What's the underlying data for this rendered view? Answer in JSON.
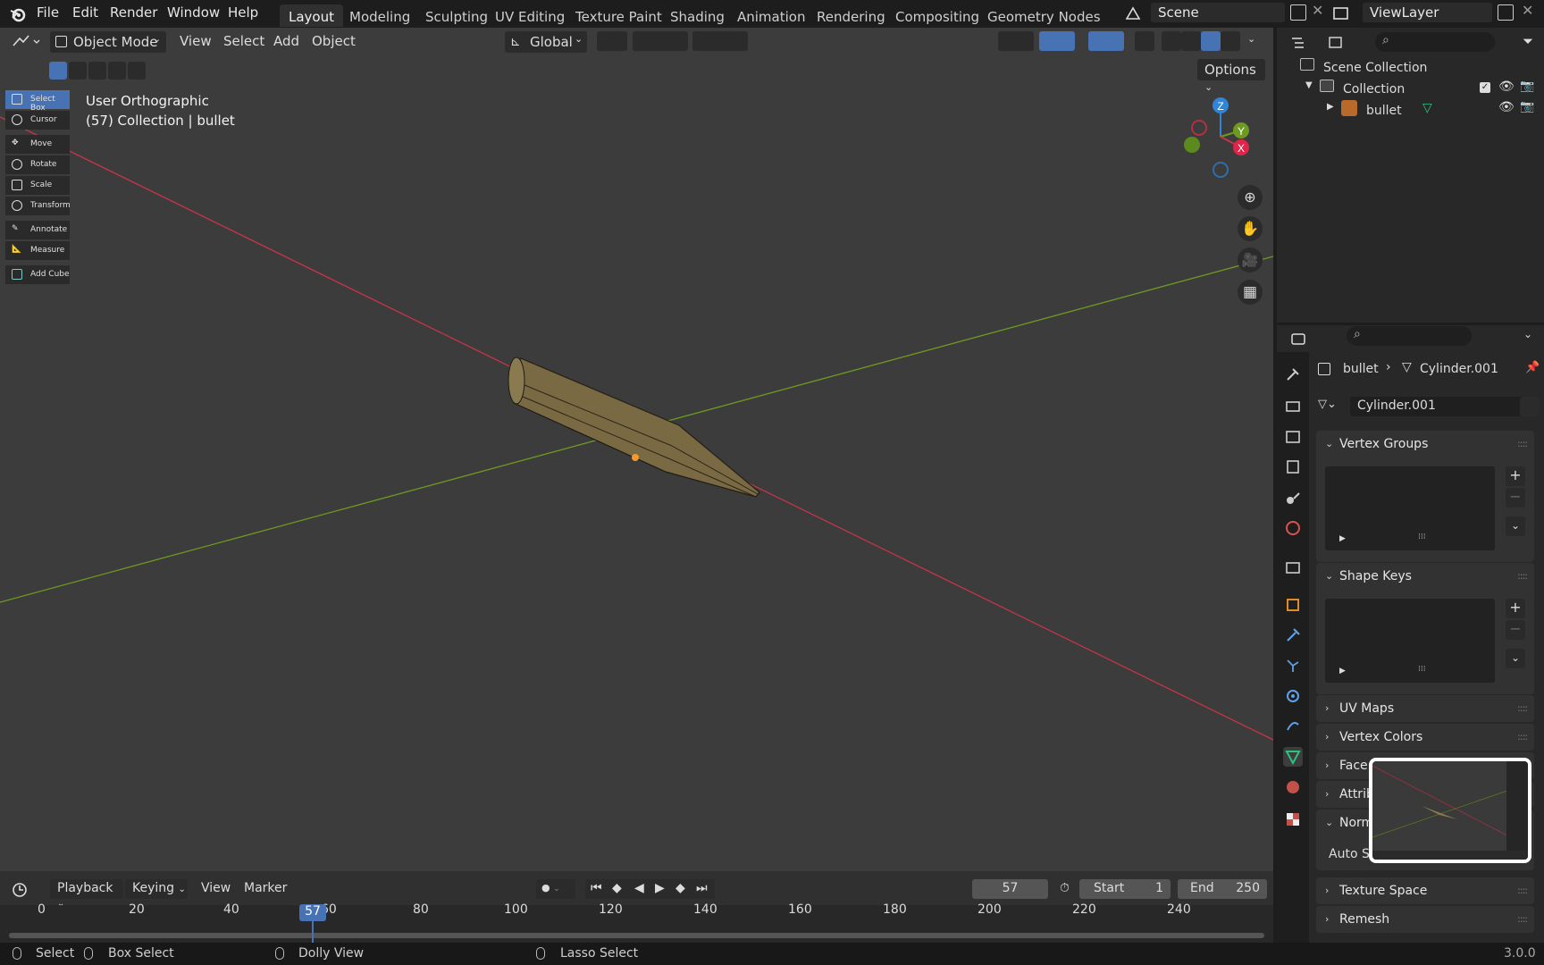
{
  "menubar": {
    "items": [
      "File",
      "Edit",
      "Render",
      "Window",
      "Help"
    ],
    "workspaces": [
      "Layout",
      "Modeling",
      "Sculpting",
      "UV Editing",
      "Texture Paint",
      "Shading",
      "Animation",
      "Rendering",
      "Compositing",
      "Geometry Nodes"
    ],
    "active_workspace": "Layout",
    "scene": "Scene",
    "view_layer": "ViewLayer"
  },
  "viewport_header": {
    "mode": "Object Mode",
    "menus": [
      "View",
      "Select",
      "Add",
      "Object"
    ],
    "orientation": "Global",
    "options": "Options"
  },
  "viewport": {
    "view_name": "User Orthographic",
    "info": "(57) Collection | bullet",
    "gizmo": {
      "x": "X",
      "y": "Y",
      "z": "Z"
    }
  },
  "toolbar": {
    "tools": [
      "Select Box",
      "Cursor",
      "Move",
      "Rotate",
      "Scale",
      "Transform",
      "Annotate",
      "Measure",
      "Add Cube"
    ],
    "active": "Select Box"
  },
  "outliner": {
    "root": "Scene Collection",
    "collection": "Collection",
    "object": "bullet"
  },
  "properties": {
    "breadcrumb_object": "bullet",
    "breadcrumb_data": "Cylinder.001",
    "mesh_name": "Cylinder.001",
    "panels": [
      "Vertex Groups",
      "Shape Keys",
      "UV Maps",
      "Vertex Colors",
      "Face Maps",
      "Attributes",
      "Normals",
      "Texture Space",
      "Remesh"
    ],
    "panel_visible_labels": [
      "Face",
      "Attrib",
      "Norm"
    ],
    "normals_field": "Auto S"
  },
  "timeline": {
    "menus": [
      "Playback",
      "Keying",
      "View",
      "Marker"
    ],
    "current_frame": "57",
    "start_label": "Start",
    "start": "1",
    "end_label": "End",
    "end": "250",
    "ruler": [
      "0",
      "20",
      "40",
      "60",
      "80",
      "100",
      "120",
      "140",
      "160",
      "180",
      "200",
      "220",
      "240"
    ]
  },
  "statusbar": {
    "select": "Select",
    "box_select": "Box Select",
    "dolly": "Dolly View",
    "lasso": "Lasso Select",
    "version": "3.0.0"
  },
  "colors": {
    "accent": "#4772b3",
    "x_axis": "#c8344a",
    "y_axis": "#6d9a1f",
    "z_axis": "#2f85d6"
  }
}
